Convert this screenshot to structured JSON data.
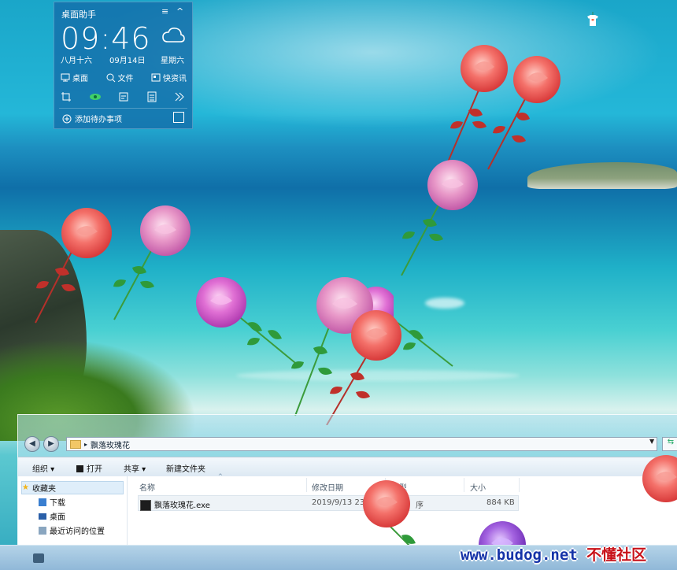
{
  "widget": {
    "title": "桌面助手",
    "menu_icon": "≡",
    "collapse_icon": "^",
    "time": "09:46",
    "lunar_date": "八月十六",
    "date": "09月14日",
    "weekday": "星期六",
    "links": [
      {
        "icon": "monitor-icon",
        "label": "桌面"
      },
      {
        "icon": "search-icon",
        "label": "文件"
      },
      {
        "icon": "news-icon",
        "label": "快资讯"
      }
    ],
    "tools": [
      "crop-icon",
      "eye-icon",
      "edit-icon",
      "calculator-icon",
      "more-icon"
    ],
    "todo_label": "添加待办事项"
  },
  "explorer": {
    "path": "飘落玫瑰花",
    "toolbar": {
      "organize": "组织",
      "open": "打开",
      "share": "共享",
      "new_folder": "新建文件夹"
    },
    "sidebar": [
      {
        "label": "收藏夹",
        "icon": "star-icon"
      },
      {
        "label": "下载",
        "icon": "download-folder-icon"
      },
      {
        "label": "桌面",
        "icon": "desktop-folder-icon"
      },
      {
        "label": "最近访问的位置",
        "icon": "recent-places-icon"
      }
    ],
    "columns": {
      "name": "名称",
      "modified": "修改日期",
      "type": "类型",
      "size": "大小"
    },
    "files": [
      {
        "name": "飘落玫瑰花.exe",
        "modified": "2019/9/13 23",
        "type": "序",
        "size": "884 KB"
      }
    ]
  },
  "watermark": {
    "site": "www.budog.net",
    "cn": "不懂社区"
  },
  "colors": {
    "widget_bg": "#146eaa",
    "rose_red": "#f0625c",
    "rose_pink": "#e48ac0",
    "rose_magenta": "#d45ac8",
    "leaf_green": "#2f9a3a"
  }
}
